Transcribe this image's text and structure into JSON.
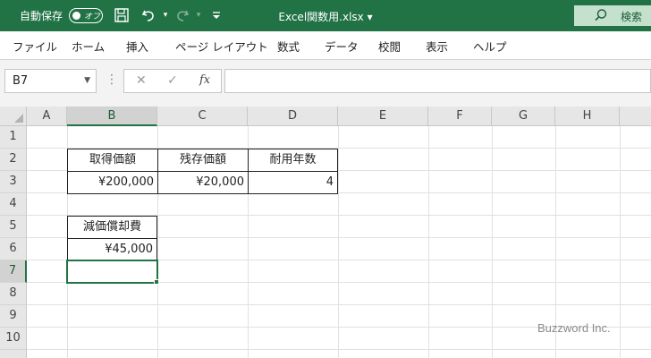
{
  "titlebar": {
    "autosave_label": "自動保存",
    "autosave_state": "オフ",
    "filename": "Excel関数用.xlsx",
    "filename_caret": "▾",
    "search_label": "検索",
    "bg_color": "#217346",
    "icons": [
      "save-icon",
      "undo-icon",
      "redo-icon",
      "customize-qat-icon",
      "search-icon"
    ]
  },
  "ribbon": {
    "tabs": [
      "ファイル",
      "ホーム",
      "挿入",
      "ページ レイアウト",
      "数式",
      "データ",
      "校閲",
      "表示",
      "ヘルプ"
    ]
  },
  "formula_bar": {
    "name_box": "B7",
    "cancel_glyph": "✕",
    "enter_glyph": "✓",
    "fx_label": "fx",
    "formula": ""
  },
  "grid": {
    "columns": [
      "A",
      "B",
      "C",
      "D",
      "E",
      "F",
      "G",
      "H"
    ],
    "rows": [
      "1",
      "2",
      "3",
      "4",
      "5",
      "6",
      "7",
      "8",
      "9",
      "10"
    ],
    "selected_column": "B",
    "selected_row": "7",
    "active_cell": "B7"
  },
  "cells": {
    "B2": "取得価額",
    "C2": "残存価額",
    "D2": "耐用年数",
    "B3": "¥200,000",
    "C3": "¥20,000",
    "D3": "4",
    "B5": "減価償却費",
    "B6": "¥45,000"
  },
  "watermark": "Buzzword Inc."
}
